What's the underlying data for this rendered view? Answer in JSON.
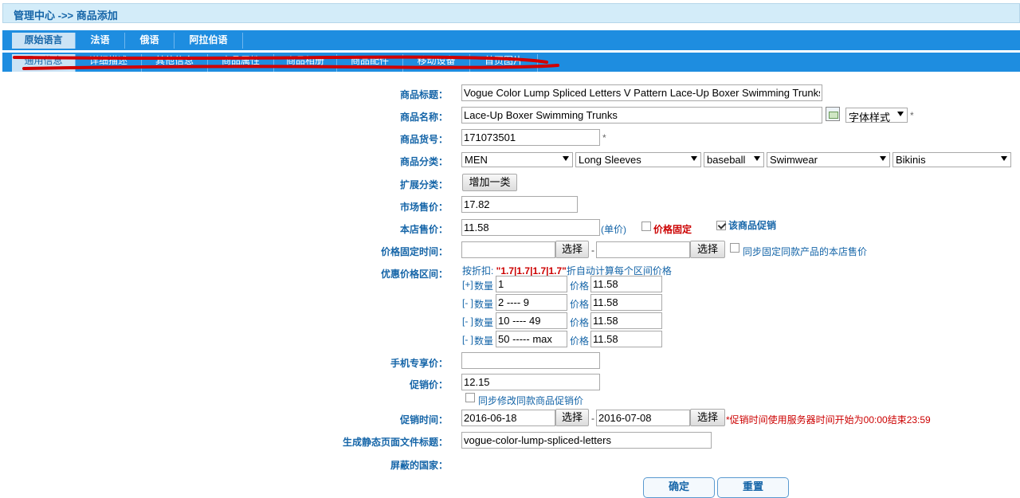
{
  "title": "管理中心 ->> 商品添加",
  "lang_tabs": [
    "原始语言",
    "法语",
    "俄语",
    "阿拉伯语"
  ],
  "sub_tabs": [
    "通用信息",
    "详细描述",
    "其他信息",
    "商品属性",
    "商品相册",
    "商品配件",
    "移动设备",
    "首页图片"
  ],
  "labels": {
    "goods_title": "商品标题：",
    "goods_name": "商品名称：",
    "goods_sn": "商品货号：",
    "category": "商品分类：",
    "ext_category": "扩展分类：",
    "market_price": "市场售价：",
    "shop_price": "本店售价：",
    "fixed_time": "价格固定时间：",
    "volume_price": "优惠价格区间：",
    "mobile_price": "手机专享价：",
    "promote_price": "促销价：",
    "promote_time": "促销时间：",
    "static_title": "生成静态页面文件标题：",
    "blocked_countries": "屏蔽的国家："
  },
  "fields": {
    "goods_title": "Vogue Color Lump Spliced Letters V Pattern Lace-Up Boxer Swimming Trunks",
    "goods_name": "Lace-Up Boxer Swimming Trunks",
    "font_style": "字体样式",
    "goods_sn": "171073501",
    "categories": [
      "MEN",
      "Long Sleeves",
      "baseball",
      "Swimwear",
      "Bikinis"
    ],
    "add_category_button": "增加一类",
    "market_price": "17.82",
    "shop_price": "11.58",
    "unit_price": "(单价)",
    "price_fixed_label": "价格固定",
    "promote_checkbox_label": "该商品促销",
    "fixed_start": "",
    "fixed_end": "",
    "select_button": "选择",
    "dash": "-",
    "sync_fixed_label": "同步固定同款产品的本店售价",
    "discount_prefix": "按折扣: ",
    "discount_values": "\"1.7|1.7|1.7|1.7\"",
    "discount_suffix": "折自动计算每个区间价格",
    "qty_label": "数量",
    "price_label": "价格",
    "tiers": [
      {
        "toggle": "[+]",
        "qty": "1",
        "price": "11.58"
      },
      {
        "toggle": "[- ]",
        "qty": "2 ---- 9",
        "price": "11.58"
      },
      {
        "toggle": "[- ]",
        "qty": "10 ---- 49",
        "price": "11.58"
      },
      {
        "toggle": "[- ]",
        "qty": "50 ----- max",
        "price": "11.58"
      }
    ],
    "mobile_price": "",
    "promote_price": "12.15",
    "sync_promote_label": "同步修改同款商品促销价",
    "promote_start": "2016-06-18",
    "promote_end": "2016-07-08",
    "promote_note": "*促销时间使用服务器时间开始为00:00结束23:59",
    "static_title": "vogue-color-lump-spliced-letters",
    "required_mark": "*"
  },
  "buttons": {
    "confirm": "确定",
    "reset": "重置"
  },
  "colors": {
    "accent": "#1e8de0",
    "label": "#1565a8",
    "annotation": "#d00000"
  }
}
